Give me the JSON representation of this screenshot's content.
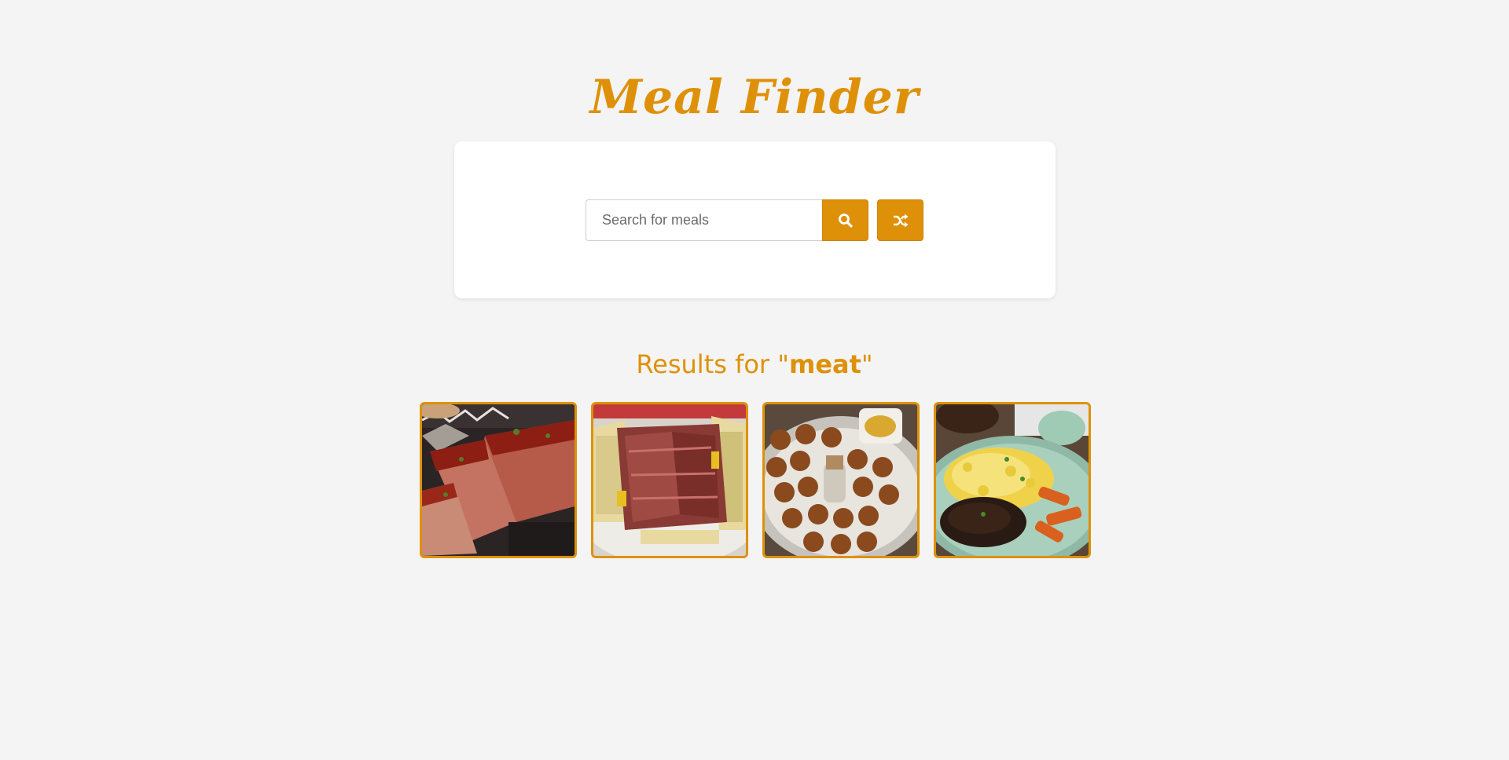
{
  "header": {
    "title": "Meal Finder"
  },
  "search": {
    "placeholder": "Search for meals",
    "value": "",
    "search_icon": "search-icon",
    "random_icon": "shuffle-icon"
  },
  "results": {
    "prefix": "Results for \"",
    "term": "meat",
    "suffix": "\""
  },
  "meals": [
    {
      "image": "meatloaf-photo"
    },
    {
      "image": "pastrami-sandwich-photo"
    },
    {
      "image": "meatballs-bowl-photo"
    },
    {
      "image": "beef-patty-with-eggs-photo"
    }
  ],
  "colors": {
    "accent": "#de9108",
    "background": "#f4f4f4",
    "card": "#ffffff"
  }
}
